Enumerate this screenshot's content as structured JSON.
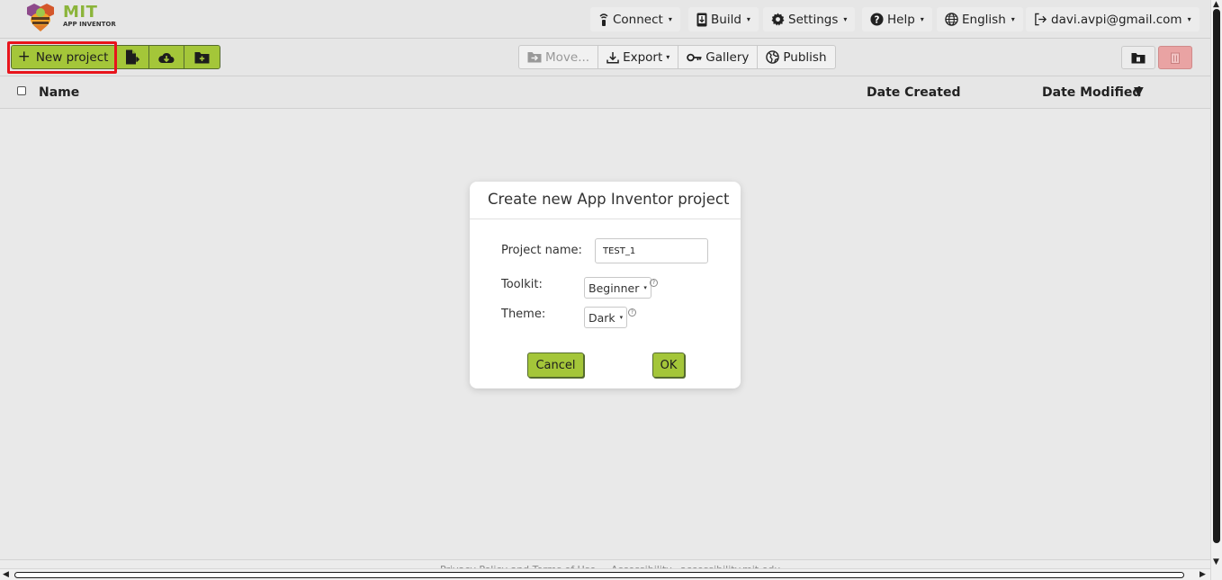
{
  "brand": {
    "title": "MIT",
    "subtitle": "APP INVENTOR",
    "accent": "#a4c639"
  },
  "topmenu": {
    "connect": "Connect",
    "build": "Build",
    "settings": "Settings",
    "help": "Help",
    "language": "English",
    "account": "davi.avpi@gmail.com"
  },
  "toolbar": {
    "new_project": "New project",
    "move": "Move...",
    "export": "Export",
    "gallery": "Gallery",
    "publish": "Publish"
  },
  "columns": {
    "name": "Name",
    "created": "Date Created",
    "modified": "Date Modified",
    "sort_indicator": "▼"
  },
  "dialog": {
    "title": "Create new App Inventor project",
    "project_name_label": "Project name:",
    "project_name_value": "TEST_1",
    "toolkit_label": "Toolkit:",
    "toolkit_value": "Beginner",
    "theme_label": "Theme:",
    "theme_value": "Dark",
    "cancel": "Cancel",
    "ok": "OK"
  },
  "footer": {
    "links": [
      "Privacy Policy and Terms of Use",
      "Accessibility",
      "accessibility.mit.edu"
    ]
  }
}
